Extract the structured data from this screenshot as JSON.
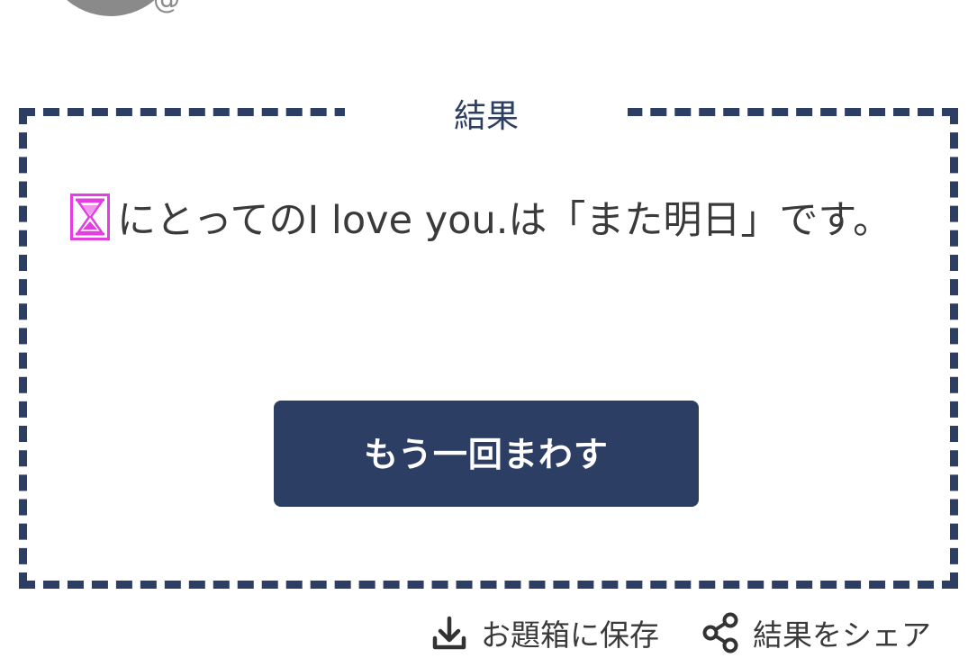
{
  "user": {
    "handle": "@"
  },
  "result": {
    "title": "結果",
    "icon": "hourglass-icon",
    "text": "にとってのI love you.は「また明日」です。"
  },
  "buttons": {
    "spin_again": "もう一回まわす"
  },
  "actions": {
    "save_label": "お題箱に保存",
    "save_icon": "download-icon",
    "share_label": "結果をシェア",
    "share_icon": "share-icon"
  },
  "colors": {
    "accent": "#2c3e63",
    "icon_magenta": "#e33fe0",
    "text": "#3a3a3a"
  }
}
